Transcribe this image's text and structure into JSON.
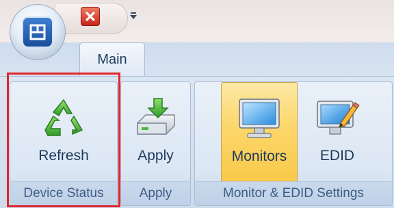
{
  "tabs": [
    {
      "label": "Main"
    }
  ],
  "groups": {
    "device_status": {
      "label": "Device Status",
      "refresh_label": "Refresh"
    },
    "apply": {
      "label": "Apply",
      "apply_label": "Apply"
    },
    "monitor_edid": {
      "label": "Monitor & EDID Settings",
      "monitors_label": "Monitors",
      "edid_label": "EDID"
    }
  },
  "colors": {
    "highlight": "#e1252b",
    "pressed": "#fcd76a",
    "text": "#1e395b",
    "group_text": "#3e5c86"
  },
  "icons": {
    "app": "app-logo-icon",
    "close": "close-icon",
    "qat": "customize-qat-icon",
    "refresh": "recycle-icon",
    "apply": "drive-download-icon",
    "monitors": "monitor-icon",
    "edid": "monitor-pencil-icon"
  }
}
